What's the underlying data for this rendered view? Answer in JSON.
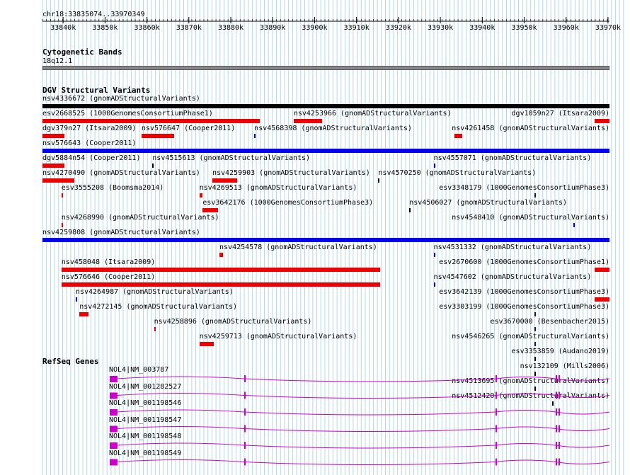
{
  "region": "chr18:33835074..33970349",
  "colors": {
    "grid": "#b4d7e6",
    "cnv_loss": "#ee0000",
    "cnv_gain": "#0000ee",
    "complex": "#000000",
    "band": "#888888",
    "gene": "#cc00cc"
  },
  "ruler": {
    "ticks": [
      "33840k",
      "33850k",
      "33860k",
      "33870k",
      "33880k",
      "33890k",
      "33900k",
      "33910k",
      "33920k",
      "33930k",
      "33940k",
      "33950k",
      "33960k",
      "33970k"
    ]
  },
  "cytobands": {
    "title": "Cytogenetic Bands",
    "band": "18q12.1"
  },
  "dgv": {
    "title": "DGV Structural Variants",
    "variants": [
      {
        "label": "nsv4336672 (gnomADStructuralVariants)",
        "type": "complex",
        "start": 33835074,
        "end": 33970349
      },
      {
        "label": "esv2668525 (1000GenomesConsortiumPhase1)",
        "type": "loss",
        "start": 33835074,
        "end": 33887000
      },
      {
        "label": "nsv4253966 (gnomADStructuralVariants)",
        "type": "loss",
        "start": 33895000,
        "end": 33901800
      },
      {
        "label": "nsv4261458 (gnomADStructuralVariants)",
        "type": "loss",
        "start": 33933300,
        "end": 33935300
      },
      {
        "label": "nsv576643 (Cooper2011)",
        "type": "gain",
        "start": 33835074,
        "end": 33970349
      },
      {
        "label": "dgv379n27 (Itsara2009)",
        "type": "loss",
        "start": 33835074,
        "end": 33840300
      },
      {
        "label": "nsv576647 (Cooper2011)",
        "type": "loss",
        "start": 33858700,
        "end": 33866500
      },
      {
        "label": "nsv4568398 (gnomADStructuralVariants)",
        "type": "gain",
        "start": 33885600,
        "end": 33885900
      },
      {
        "label": "nsv4557071 (gnomADStructuralVariants)",
        "type": "gain",
        "start": 33928400,
        "end": 33928700
      },
      {
        "label": "dgv1059n27 (Itsara2009)",
        "type": "loss",
        "start": 33966800,
        "end": 33970349
      },
      {
        "label": "dgv5884n54 (Cooper2011)",
        "type": "loss",
        "start": 33835074,
        "end": 33840300
      },
      {
        "label": "nsv4515613 (gnomADStructuralVariants)",
        "type": "complex",
        "start": 33861300,
        "end": 33861600
      },
      {
        "label": "nsv4570250 (gnomADStructuralVariants)",
        "type": "complex",
        "start": 33915200,
        "end": 33915500
      },
      {
        "label": "esv3348179 (1000GenomesConsortiumPhase3)",
        "type": "gain",
        "start": 33952400,
        "end": 33952700
      },
      {
        "label": "nsv4270490 (gnomADStructuralVariants)",
        "type": "loss",
        "start": 33835074,
        "end": 33842700
      },
      {
        "label": "nsv4269513 (gnomADStructuralVariants)",
        "type": "loss",
        "start": 33872500,
        "end": 33873200
      },
      {
        "label": "nsv4506027 (gnomADStructuralVariants)",
        "type": "complex",
        "start": 33922600,
        "end": 33922900
      },
      {
        "label": "nsv4548410 (gnomADStructuralVariants)",
        "type": "gain",
        "start": 33961800,
        "end": 33962100
      },
      {
        "label": "nsv4259808 (gnomADStructuralVariants)",
        "type": "gain",
        "start": 33835074,
        "end": 33970349
      },
      {
        "label": "esv3555208 (Boomsma2014)",
        "type": "loss",
        "start": 33839600,
        "end": 33839900
      },
      {
        "label": "esv3642176 (1000GenomesConsortiumPhase3)",
        "type": "loss",
        "start": 33873300,
        "end": 33877000
      },
      {
        "label": "nsv4531332 (gnomADStructuralVariants)",
        "type": "gain",
        "start": 33928400,
        "end": 33928700
      },
      {
        "label": "esv2670600 (1000GenomesConsortiumPhase1)",
        "type": "loss",
        "start": 33966800,
        "end": 33970349
      },
      {
        "label": "nsv4268990 (gnomADStructuralVariants)",
        "type": "loss",
        "start": 33839600,
        "end": 33839900
      },
      {
        "label": "nsv4254578 (gnomADStructuralVariants)",
        "type": "loss",
        "start": 33877300,
        "end": 33878200
      },
      {
        "label": "nsv4547602 (gnomADStructuralVariants)",
        "type": "gain",
        "start": 33928400,
        "end": 33928700
      },
      {
        "label": "esv3642139 (1000GenomesConsortiumPhase3)",
        "type": "loss",
        "start": 33966800,
        "end": 33970349
      },
      {
        "label": "nsv458048 (Itsara2009)",
        "type": "loss",
        "start": 33839600,
        "end": 33915600
      },
      {
        "label": "esv3303199 (1000GenomesConsortiumPhase3)",
        "type": "gain",
        "start": 33952400,
        "end": 33952700
      },
      {
        "label": "nsv576646 (Cooper2011)",
        "type": "loss",
        "start": 33839600,
        "end": 33915600
      },
      {
        "label": "esv3670000 (Besenbacher2015)",
        "type": "gain",
        "start": 33952400,
        "end": 33952700
      },
      {
        "label": "nsv4264987 (gnomADStructuralVariants)",
        "type": "gain",
        "start": 33843000,
        "end": 33843300
      },
      {
        "label": "nsv4546265 (gnomADStructuralVariants)",
        "type": "gain",
        "start": 33952400,
        "end": 33952700
      },
      {
        "label": "nsv4272145 (gnomADStructuralVariants)",
        "type": "loss",
        "start": 33843900,
        "end": 33846000
      },
      {
        "label": "esv3353859 (Audano2019)",
        "type": "complex",
        "start": 33952400,
        "end": 33952700
      },
      {
        "label": "nsv4258896 (gnomADStructuralVariants)",
        "type": "loss",
        "start": 33861700,
        "end": 33862000
      },
      {
        "label": "nsv132109 (Mills2006)",
        "type": "complex",
        "start": 33952400,
        "end": 33952700
      },
      {
        "label": "nsv4259713 (gnomADStructuralVariants)",
        "type": "loss",
        "start": 33872500,
        "end": 33876000
      },
      {
        "label": "nsv4513695 (gnomADStructuralVariants)",
        "type": "complex",
        "start": 33952400,
        "end": 33952700
      },
      {
        "label": "nsv4259903 (gnomADStructuralVariants)",
        "type": "loss",
        "start": 33875600,
        "end": 33881600
      },
      {
        "label": "nsv4512420 (gnomADStructuralVariants)",
        "type": "complex",
        "start": 33956700,
        "end": 33957000
      }
    ]
  },
  "refseq": {
    "title": "RefSeq Genes",
    "genes": [
      {
        "label": "NOL4|NM_003787"
      },
      {
        "label": "NOL4|NM_001282527"
      },
      {
        "label": "NOL4|NM_001198546"
      },
      {
        "label": "NOL4|NM_001198547"
      },
      {
        "label": "NOL4|NM_001198548"
      },
      {
        "label": "NOL4|NM_001198549"
      }
    ]
  }
}
